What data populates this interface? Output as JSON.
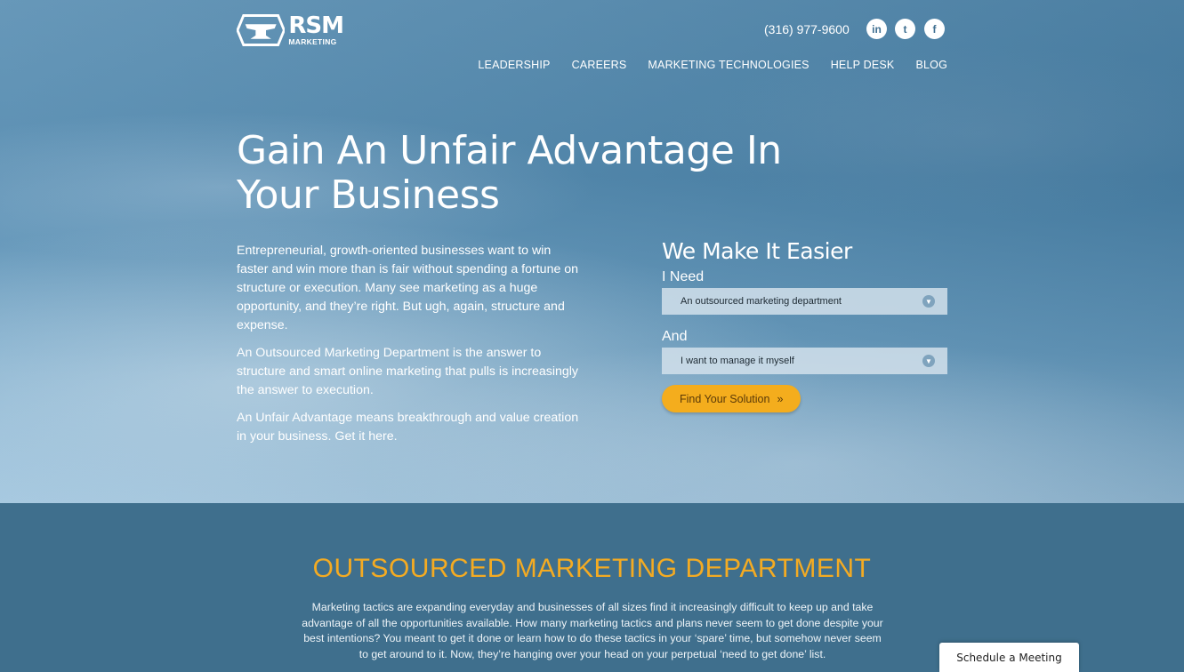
{
  "brand": {
    "logo_main": "RSM",
    "logo_sub": "MARKETING"
  },
  "header": {
    "phone": "(316) 977-9600",
    "social": [
      {
        "icon": "linkedin-icon",
        "glyph": "in"
      },
      {
        "icon": "twitter-icon",
        "glyph": "t"
      },
      {
        "icon": "facebook-icon",
        "glyph": "f"
      }
    ]
  },
  "nav": [
    {
      "label": "LEADERSHIP"
    },
    {
      "label": "CAREERS"
    },
    {
      "label": "MARKETING TECHNOLOGIES"
    },
    {
      "label": "HELP DESK"
    },
    {
      "label": "BLOG"
    }
  ],
  "hero": {
    "headline_line1": "Gain An Unfair Advantage In",
    "headline_line2": "Your Business",
    "paragraphs": [
      "Entrepreneurial, growth-oriented businesses want to win faster and win more than is fair without spending a fortune on structure or execution. Many see marketing as a huge opportunity, and they’re right. But ugh, again, structure and expense.",
      "An Outsourced Marketing Department is the answer to structure and smart online marketing that pulls is increasingly the answer to execution.",
      "An Unfair Advantage means breakthrough and value creation in your business. Get it here."
    ]
  },
  "finder": {
    "title": "We Make It Easier",
    "need_label": "I Need",
    "need_value": "An outsourced marketing department",
    "and_label": "And",
    "and_value": "I want to manage it myself",
    "button_label": "Find Your Solution",
    "button_arrow": "»"
  },
  "section": {
    "title": "OUTSOURCED MARKETING DEPARTMENT",
    "body": "Marketing tactics are expanding everyday and businesses of all sizes find it increasingly difficult to keep up and take advantage of all the opportunities available. How many marketing tactics and plans never seem to get done despite your best intentions? You meant to get it done or learn how to do these tactics in your ‘spare’ time, but somehow never seem to get around to it. Now, they’re hanging over your head on your perpetual ‘need to get done’ list."
  },
  "widget": {
    "schedule_label": "Schedule a Meeting"
  }
}
